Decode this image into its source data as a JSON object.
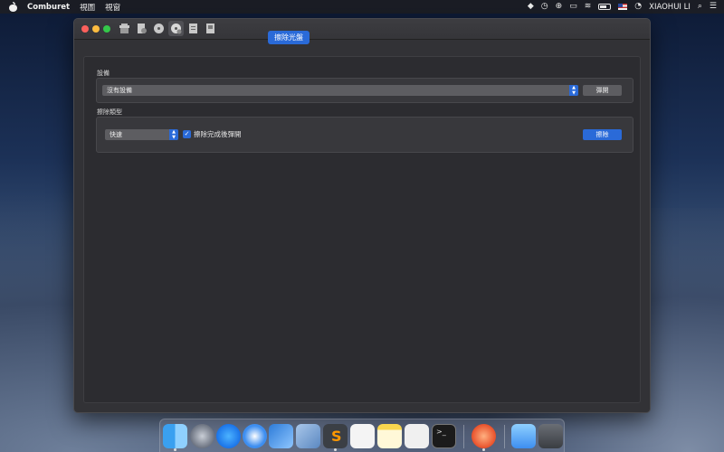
{
  "menubar": {
    "app_name": "Comburet",
    "menus": [
      "視圖",
      "視窗"
    ],
    "user_name": "XIAOHUI LI"
  },
  "toolbar": {
    "icons": [
      "burn-icon",
      "image-icon",
      "copy-disc-icon",
      "erase-disc-icon",
      "info-icon",
      "save-icon"
    ],
    "active_index": 3
  },
  "main": {
    "tab_title": "擦除光盤",
    "device_group": {
      "label": "設備",
      "device_value": "沒有設備",
      "eject_label": "彈開"
    },
    "erase_group": {
      "label": "擦除類型",
      "speed_value": "快速",
      "eject_after_label": "擦除完成後彈開",
      "eject_after_checked": true,
      "erase_label": "擦除"
    }
  },
  "dock": {
    "apps": [
      "finder",
      "launchpad",
      "app-store",
      "safari",
      "xcode",
      "virtualbox",
      "sublime-text",
      "reminders",
      "notes",
      "textedit",
      "terminal",
      "comburet",
      "downloads-folder",
      "trash"
    ]
  },
  "colors": {
    "accent": "#2a6ad8",
    "window_bg": "#323236"
  }
}
